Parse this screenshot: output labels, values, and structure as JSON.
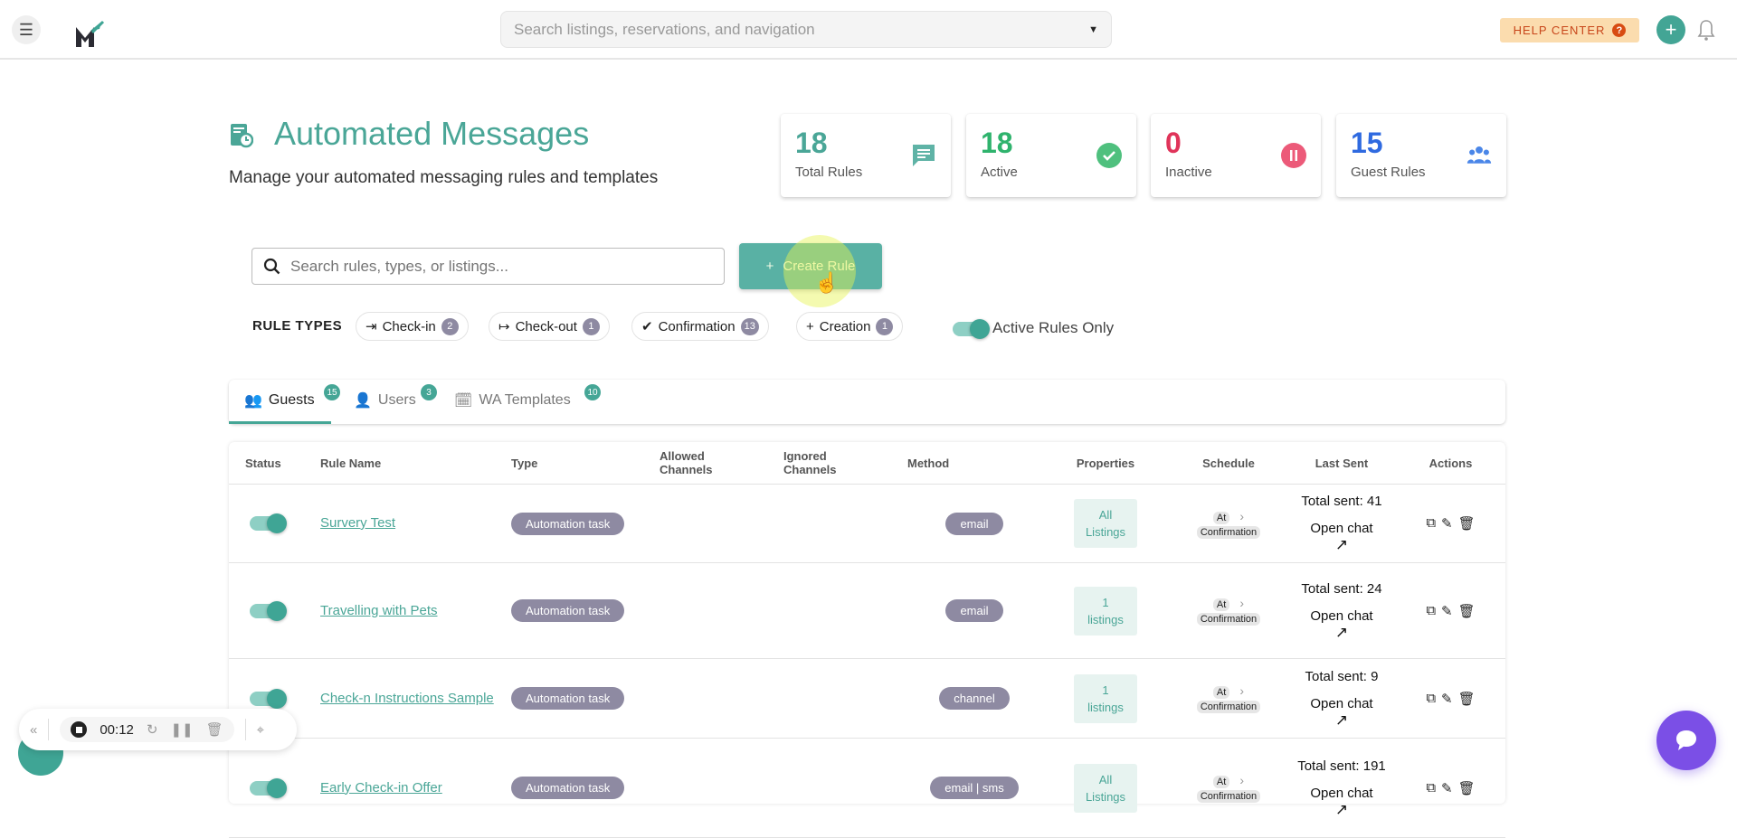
{
  "header": {
    "search_placeholder": "Search listings, reservations, and navigation",
    "help_center": "HELP CENTER",
    "help_icon": "?"
  },
  "page": {
    "title": "Automated Messages",
    "subtitle": "Manage your automated messaging rules and templates"
  },
  "stats": [
    {
      "value": "18",
      "label": "Total Rules",
      "color": "#4aa697"
    },
    {
      "value": "18",
      "label": "Active",
      "color": "#2fb36d"
    },
    {
      "value": "0",
      "label": "Inactive",
      "color": "#e0345a"
    },
    {
      "value": "15",
      "label": "Guest Rules",
      "color": "#2f6ae0"
    }
  ],
  "toolbar": {
    "search_placeholder": "Search rules, types, or listings...",
    "create_label": "Create Rule",
    "create_icon": "+"
  },
  "rule_types": {
    "label": "RULE TYPES",
    "chips": [
      {
        "label": "Check-in",
        "count": "2",
        "icon": "⇥"
      },
      {
        "label": "Check-out",
        "count": "1",
        "icon": "↦"
      },
      {
        "label": "Confirmation",
        "count": "13",
        "icon": "✔"
      },
      {
        "label": "Creation",
        "count": "1",
        "icon": "+"
      }
    ],
    "active_only": "Active Rules Only"
  },
  "tabs": [
    {
      "label": "Guests",
      "count": "15"
    },
    {
      "label": "Users",
      "count": "3"
    },
    {
      "label": "WA Templates",
      "count": "10"
    }
  ],
  "table": {
    "headers": {
      "status": "Status",
      "rule_name": "Rule Name",
      "type": "Type",
      "allowed1": "Allowed",
      "allowed2": "Channels",
      "ignored1": "Ignored",
      "ignored2": "Channels",
      "method": "Method",
      "properties": "Properties",
      "schedule": "Schedule",
      "last_sent": "Last Sent",
      "actions": "Actions"
    },
    "rows": [
      {
        "name": "Survery Test",
        "type": "Automation task",
        "method": "email",
        "prop1": "All",
        "prop2": "Listings",
        "at": "At",
        "when": "Confirmation",
        "sent": "Total sent: 41",
        "open": "Open chat"
      },
      {
        "name": "Travelling with Pets",
        "type": "Automation task",
        "method": "email",
        "prop1": "1",
        "prop2": "listings",
        "at": "At",
        "when": "Confirmation",
        "sent": "Total sent: 24",
        "open": "Open chat"
      },
      {
        "name": "Check-n Instructions Sample",
        "type": "Automation task",
        "method": "channel",
        "prop1": "1",
        "prop2": "listings",
        "at": "At",
        "when": "Confirmation",
        "sent": "Total sent: 9",
        "open": "Open chat"
      },
      {
        "name": "Early Check-in Offer",
        "type": "Automation task",
        "method": "email | sms",
        "prop1": "All",
        "prop2": "Listings",
        "at": "At",
        "when": "Confirmation",
        "sent": "Total sent: 191",
        "open": "Open chat"
      }
    ]
  },
  "recorder": {
    "time": "00:12"
  }
}
